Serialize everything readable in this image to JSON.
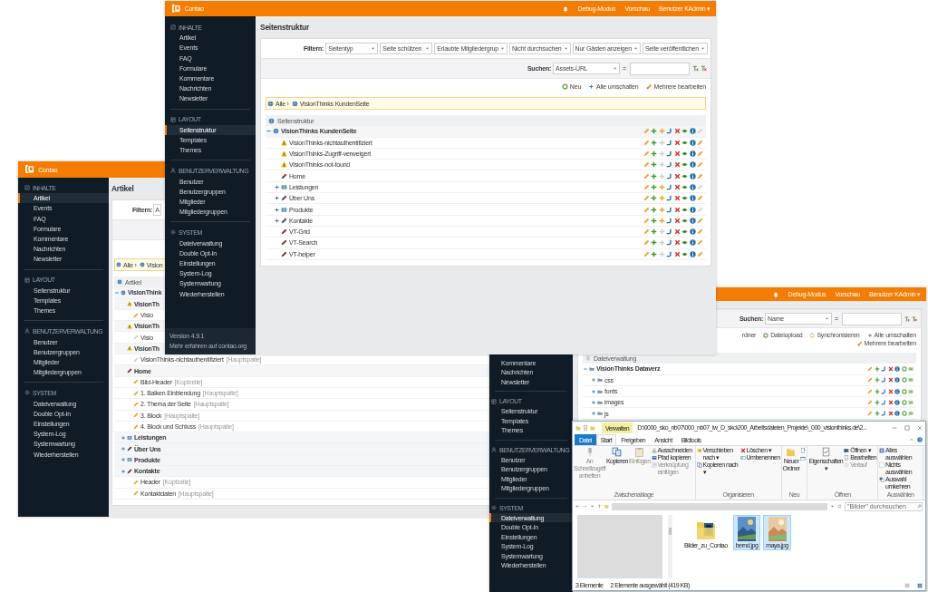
{
  "article_window": {
    "logo": "Contao",
    "sidebar": [
      {
        "kind": "content",
        "label": "INHALTE",
        "items": [
          {
            "label": "Artikel",
            "selected": true
          },
          {
            "label": "Events",
            "selected": false
          },
          {
            "label": "FAQ",
            "selected": false
          },
          {
            "label": "Formulare",
            "selected": false
          },
          {
            "label": "Kommentare",
            "selected": false
          },
          {
            "label": "Nachrichten",
            "selected": false
          },
          {
            "label": "Newsletter",
            "selected": false
          }
        ]
      },
      {
        "kind": "layout",
        "label": "LAYOUT",
        "items": [
          {
            "label": "Seitenstruktur",
            "selected": false
          },
          {
            "label": "Templates",
            "selected": false
          },
          {
            "label": "Themes",
            "selected": false
          }
        ]
      },
      {
        "kind": "users",
        "label": "BENUTZERVERWALTUNG",
        "items": [
          {
            "label": "Benutzer",
            "selected": false
          },
          {
            "label": "Benutzergruppen",
            "selected": false
          },
          {
            "label": "Mitglieder",
            "selected": false
          },
          {
            "label": "Mitgliedergruppen",
            "selected": false
          }
        ]
      },
      {
        "kind": "system",
        "label": "SYSTEM",
        "items": [
          {
            "label": "Dateiverwaltung",
            "selected": false
          },
          {
            "label": "Double Opt-In",
            "selected": false
          },
          {
            "label": "Einstellungen",
            "selected": false
          },
          {
            "label": "System-Log",
            "selected": false
          },
          {
            "label": "Systemwartung",
            "selected": false
          },
          {
            "label": "Wiederherstellen",
            "selected": false
          }
        ]
      }
    ],
    "title": "Artikel",
    "filter_label": "Filtern:",
    "filters": [
      "A"
    ],
    "breadcrumb": [
      "Alle ›",
      "Vision"
    ],
    "tree": {
      "kind": "article",
      "header": "Artikel",
      "rows": [
        {
          "kind": "root",
          "label": "VisionThink",
          "expanded": true,
          "children": [
            {
              "kind": "error",
              "label": "VisionTh",
              "children": [
                {
                  "kind": "article",
                  "label": "Visio",
                  "published": true
                }
              ]
            },
            {
              "kind": "error",
              "label": "VisionTh",
              "children": [
                {
                  "kind": "article",
                  "label": "Visio",
                  "published": false
                }
              ]
            },
            {
              "kind": "error",
              "label": "VisionTh",
              "children": [
                {
                  "kind": "article",
                  "label": "VisionThinks-nichtauthentifiziert",
                  "column": "[Hauptspalte]",
                  "published": false
                }
              ]
            },
            {
              "kind": "regular",
              "label": "Home",
              "children": [
                {
                  "kind": "article",
                  "label": "Bild-Header",
                  "column": "[Kopfzeile]",
                  "published": true
                },
                {
                  "kind": "article",
                  "label": "1. Balken Einblendung",
                  "column": "[Hauptspalte]",
                  "published": true
                },
                {
                  "kind": "article",
                  "label": "2. Thema der Seite",
                  "column": "[Hauptspalte]",
                  "published": true
                },
                {
                  "kind": "article",
                  "label": "3. Block",
                  "column": "[Hauptspalte]",
                  "published": true
                },
                {
                  "kind": "article",
                  "label": "4. Block und Schluss",
                  "column": "[Hauptspalte]",
                  "published": true
                }
              ]
            },
            {
              "kind": "forward",
              "label": "Leistungen",
              "expanded": false
            },
            {
              "kind": "regular",
              "label": "Über Uns",
              "expanded": false
            },
            {
              "kind": "forward",
              "label": "Produkte",
              "expanded": false
            },
            {
              "kind": "regular",
              "label": "Kontakte",
              "expanded": false,
              "children": [
                {
                  "kind": "article",
                  "label": "Header",
                  "column": "[Kopfzeile]",
                  "published": true
                },
                {
                  "kind": "article",
                  "label": "Kontaktdaten",
                  "column": "[Hauptspalte]",
                  "published": true
                }
              ]
            }
          ]
        }
      ]
    }
  },
  "file_window": {
    "header_links": [
      "Debug-Modus",
      "Vorschau",
      "Benutzer KAdmin ▾"
    ],
    "sidebar": [
      {
        "items": [
          {
            "label": "Kommentare",
            "selected": false
          },
          {
            "label": "Nachrichten",
            "selected": false
          },
          {
            "label": "Newsletter",
            "selected": false
          }
        ]
      },
      {
        "kind": "layout",
        "label": "LAYOUT",
        "items": [
          {
            "label": "Seitenstruktur",
            "selected": false
          },
          {
            "label": "Templates",
            "selected": false
          },
          {
            "label": "Themes",
            "selected": false
          }
        ]
      },
      {
        "kind": "users",
        "label": "BENUTZERVERWALTUNG",
        "items": [
          {
            "label": "Benutzer",
            "selected": false
          },
          {
            "label": "Benutzergruppen",
            "selected": false
          },
          {
            "label": "Mitglieder",
            "selected": false
          },
          {
            "label": "Mitgliedergruppen",
            "selected": false
          }
        ]
      },
      {
        "kind": "system",
        "label": "SYSTEM",
        "items": [
          {
            "label": "Dateiverwaltung",
            "selected": true
          },
          {
            "label": "Double Opt-In",
            "selected": false
          },
          {
            "label": "Einstellungen",
            "selected": false
          },
          {
            "label": "System-Log",
            "selected": false
          },
          {
            "label": "Systemwartung",
            "selected": false
          },
          {
            "label": "Wiederherstellen",
            "selected": false
          }
        ]
      }
    ],
    "search": {
      "label": "Suchen:",
      "field": "Name",
      "operator": "="
    },
    "toolbar": [
      {
        "kind": "text",
        "label": "rdner"
      },
      {
        "kind": "upload",
        "label": "Dateiupload"
      },
      {
        "kind": "sync",
        "label": "Synchronisieren"
      },
      {
        "kind": "toggle",
        "label": "Alle umschalten"
      },
      {
        "kind": "edit",
        "label": "Mehrere bearbeiten"
      }
    ],
    "tree": {
      "kind": "file",
      "header": "Dateiverwaltung",
      "rows": [
        {
          "label": "VisionThinks Dataverz",
          "expanded": true,
          "children": [
            {
              "label": "css",
              "expanded": false
            },
            {
              "label": "fonts",
              "expanded": false
            },
            {
              "label": "images",
              "expanded": false
            },
            {
              "label": "js",
              "expanded": false
            }
          ]
        }
      ]
    }
  },
  "page_window": {
    "logo": "Contao",
    "header_links": [
      "Debug-Modus",
      "Vorschau",
      "Benutzer KAdmin ▾"
    ],
    "sidebar": [
      {
        "kind": "content",
        "label": "INHALTE",
        "items": [
          {
            "label": "Artikel",
            "selected": false
          },
          {
            "label": "Events",
            "selected": false
          },
          {
            "label": "FAQ",
            "selected": false
          },
          {
            "label": "Formulare",
            "selected": false
          },
          {
            "label": "Kommentare",
            "selected": false
          },
          {
            "label": "Nachrichten",
            "selected": false
          },
          {
            "label": "Newsletter",
            "selected": false
          }
        ]
      },
      {
        "kind": "layout",
        "label": "LAYOUT",
        "items": [
          {
            "label": "Seitenstruktur",
            "selected": true
          },
          {
            "label": "Templates",
            "selected": false
          },
          {
            "label": "Themes",
            "selected": false
          }
        ]
      },
      {
        "kind": "users",
        "label": "BENUTZERVERWALTUNG",
        "items": [
          {
            "label": "Benutzer",
            "selected": false
          },
          {
            "label": "Benutzergruppen",
            "selected": false
          },
          {
            "label": "Mitglieder",
            "selected": false
          },
          {
            "label": "Mitgliedergruppen",
            "selected": false
          }
        ]
      },
      {
        "kind": "system",
        "label": "SYSTEM",
        "items": [
          {
            "label": "Dateiverwaltung",
            "selected": false
          },
          {
            "label": "Double Opt-In",
            "selected": false
          },
          {
            "label": "Einstellungen",
            "selected": false
          },
          {
            "label": "System-Log",
            "selected": false
          },
          {
            "label": "Systemwartung",
            "selected": false
          },
          {
            "label": "Wiederherstellen",
            "selected": false
          }
        ]
      }
    ],
    "version": [
      "Version 4.9.1",
      "Mehr erfahren auf contao.org"
    ],
    "title": "Seitenstruktur",
    "filter_label": "Filtern:",
    "filters": [
      "Seitentyp",
      "Seite schützen",
      "Erlaubte Mitgliedergrup",
      "Nicht durchsuchen",
      "Nur Gästen anzeigen",
      "Seite veröffentlichen"
    ],
    "search": {
      "label": "Suchen:",
      "field": "Assets-URL",
      "operator": "="
    },
    "toolbar": [
      {
        "kind": "new",
        "label": "Neu"
      },
      {
        "kind": "toggle",
        "label": "Alle umschalten"
      },
      {
        "kind": "edit",
        "label": "Mehrere bearbeiten"
      }
    ],
    "breadcrumb": [
      "Alle ›",
      "VisionThinks KundenSeite"
    ],
    "tree": {
      "kind": "page",
      "header": "Seitenstruktur",
      "rows": [
        {
          "kind": "root",
          "label": "VisionThinks KundenSeite",
          "expanded": true,
          "paste_enabled": true,
          "header_edit_enabled": false,
          "children": [
            {
              "kind": "error",
              "label": "VisionThinks-nichtauthentifiziert",
              "paste_enabled": false,
              "header_edit_enabled": true
            },
            {
              "kind": "error",
              "label": "VisionThinks-Zugriff-verweigert",
              "paste_enabled": false,
              "header_edit_enabled": true
            },
            {
              "kind": "error",
              "label": "VisionThinks-not-found",
              "paste_enabled": false,
              "header_edit_enabled": true
            },
            {
              "kind": "regular",
              "label": "Home",
              "paste_enabled": false,
              "header_edit_enabled": true
            },
            {
              "kind": "forward",
              "label": "Leistungen",
              "expanded": false,
              "paste_enabled": true,
              "header_edit_enabled": false
            },
            {
              "kind": "regular",
              "label": "Über Uns",
              "expanded": false,
              "paste_enabled": true,
              "header_edit_enabled": true
            },
            {
              "kind": "forward",
              "label": "Produkte",
              "expanded": false,
              "paste_enabled": true,
              "header_edit_enabled": false
            },
            {
              "kind": "regular",
              "label": "Kontakte",
              "expanded": false,
              "paste_enabled": true,
              "header_edit_enabled": true
            },
            {
              "kind": "regular",
              "label": "VT-Grid",
              "paste_enabled": false,
              "header_edit_enabled": true
            },
            {
              "kind": "regular",
              "label": "VT-Search",
              "paste_enabled": false,
              "header_edit_enabled": true
            },
            {
              "kind": "regular",
              "label": "VT-helper",
              "paste_enabled": false,
              "header_edit_enabled": true
            }
          ]
        }
      ]
    }
  },
  "explorer_window": {
    "context_label": "Verwalten",
    "path": "D:\\0000_sko_nb07\\000_nb07_lw_D_sko\\200_Arbeitsdateien_Projekte\\_000_visionthinks.de\\2...",
    "tabs": [
      {
        "label": "Datei",
        "kind": "menu",
        "selected": false
      },
      {
        "label": "Start",
        "kind": "tab",
        "selected": true
      },
      {
        "label": "Freigeben",
        "kind": "tab",
        "selected": false
      },
      {
        "label": "Ansicht",
        "kind": "tab",
        "selected": false
      },
      {
        "label": "Bildtools",
        "kind": "tab",
        "selected": false
      }
    ],
    "ribbon": [
      {
        "label": "Zwischenablage",
        "columns": [
          [
            {
              "kind": "large",
              "label": "An Schnellzugriff anheften",
              "disabled": true
            }
          ],
          [
            {
              "kind": "large",
              "label": "Kopieren",
              "disabled": false
            }
          ],
          [
            {
              "kind": "large",
              "label": "Einfügen",
              "disabled": true
            }
          ],
          [
            {
              "kind": "small",
              "label": "Ausschneiden",
              "disabled": false
            },
            {
              "kind": "small",
              "label": "Pfad kopieren",
              "disabled": false
            },
            {
              "kind": "small",
              "label": "Verknüpfung einfügen",
              "disabled": true
            }
          ]
        ]
      },
      {
        "label": "Organisieren",
        "columns": [
          [
            {
              "kind": "small",
              "label": "Verschieben nach ▾",
              "disabled": false
            },
            {
              "kind": "small",
              "label": "Kopieren nach ▾",
              "disabled": false
            }
          ],
          [
            {
              "kind": "small",
              "label": "Löschen ▾",
              "disabled": false
            },
            {
              "kind": "small",
              "label": "Umbenennen",
              "disabled": false
            }
          ]
        ]
      },
      {
        "label": "Neu",
        "columns": [
          [
            {
              "kind": "large",
              "label": "Neuer Ordner",
              "disabled": false
            }
          ],
          [
            {
              "kind": "icon",
              "disabled": false
            },
            {
              "kind": "icon",
              "disabled": false
            }
          ]
        ]
      },
      {
        "label": "Öffnen",
        "columns": [
          [
            {
              "kind": "large",
              "label": "Eigenschaften ▾",
              "disabled": false
            }
          ],
          [
            {
              "kind": "small",
              "label": "Öffnen ▾",
              "disabled": false
            },
            {
              "kind": "small",
              "label": "Bearbeiten",
              "disabled": false
            },
            {
              "kind": "small",
              "label": "Verlauf",
              "disabled": true
            }
          ]
        ]
      },
      {
        "label": "Auswählen",
        "columns": [
          [
            {
              "kind": "small",
              "label": "Alles auswählen",
              "disabled": false
            },
            {
              "kind": "small",
              "label": "Nichts auswählen",
              "disabled": false
            },
            {
              "kind": "small",
              "label": "Auswahl umkehren",
              "disabled": false
            }
          ]
        ]
      }
    ],
    "search_placeholder": "\"Bilder\" durchsuchen",
    "files": [
      {
        "kind": "folder",
        "label": "Bilder_zu_Contao",
        "selected": false
      },
      {
        "kind": "picture",
        "label": "bernd.jpg",
        "selected": true
      },
      {
        "kind": "picture",
        "label": "maya.jpg",
        "selected": true
      }
    ],
    "status": [
      "3 Elemente",
      "2 Elemente ausgewählt (419 KB)"
    ]
  }
}
